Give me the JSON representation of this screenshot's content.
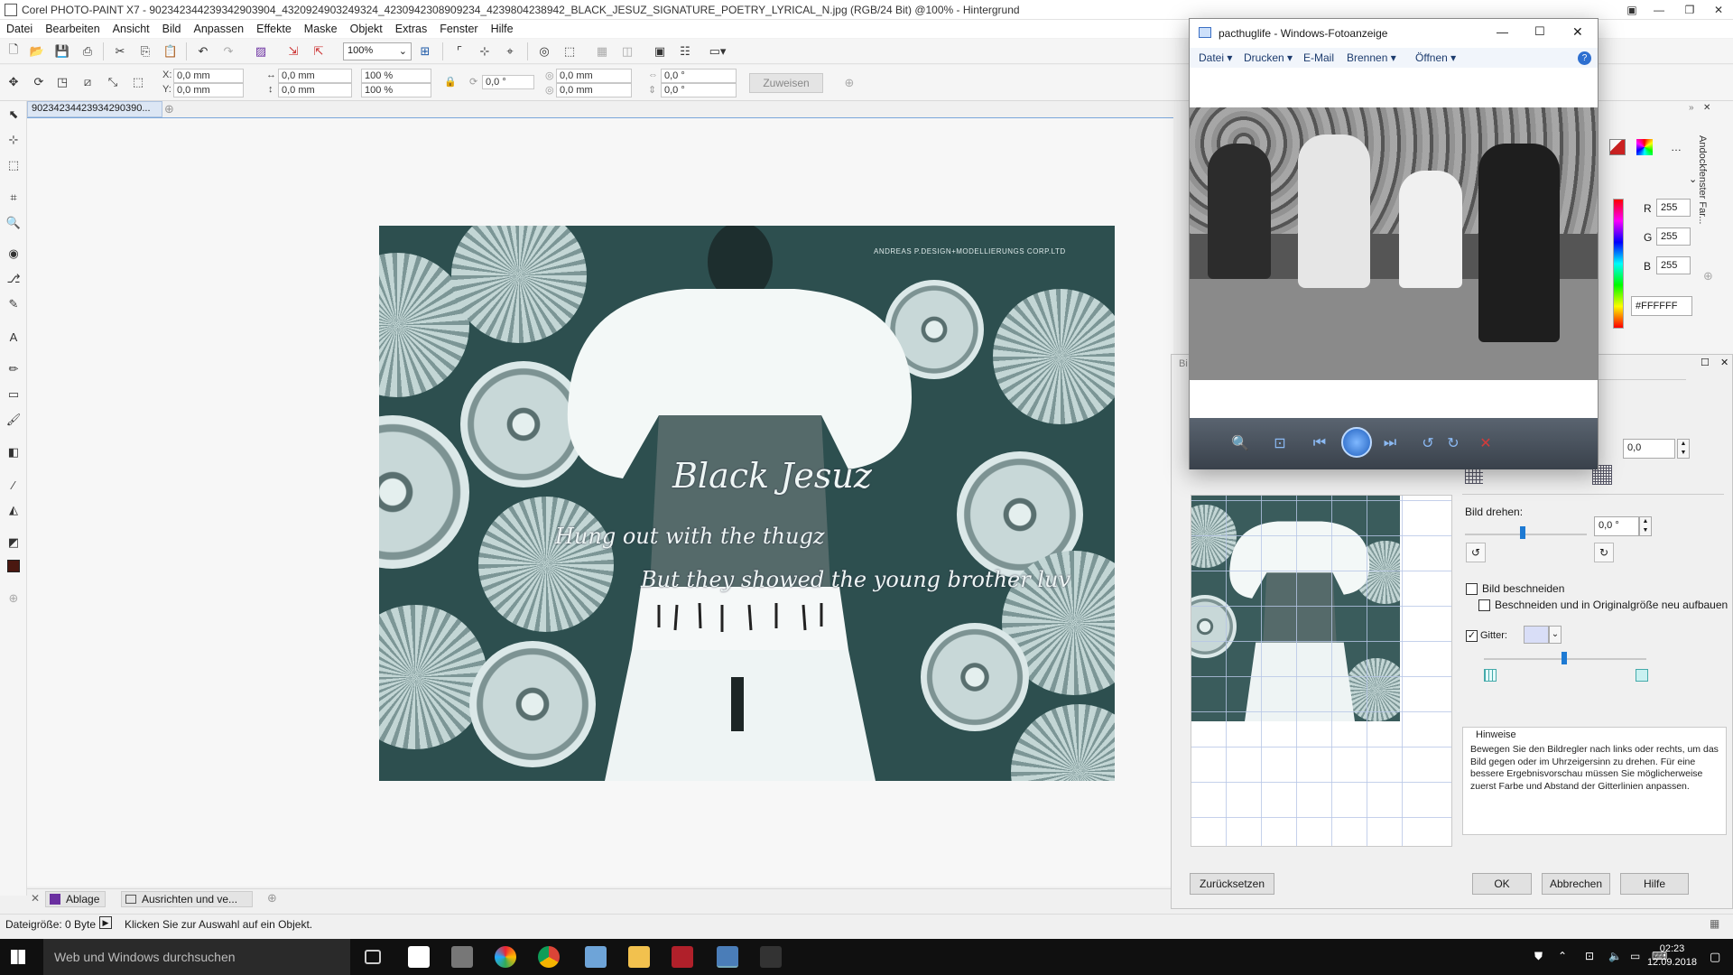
{
  "app": {
    "title": "Corel PHOTO-PAINT X7 - 902342344239342903904_4320924903249324_4230942308909234_4239804238942_BLACK_JESUZ_SIGNATURE_POETRY_LYRICAL_N.jpg (RGB/24 Bit) @100% - Hintergrund"
  },
  "menu": [
    "Datei",
    "Bearbeiten",
    "Ansicht",
    "Bild",
    "Anpassen",
    "Effekte",
    "Maske",
    "Objekt",
    "Extras",
    "Fenster",
    "Hilfe"
  ],
  "toolbar": {
    "zoom": "100%",
    "x_label": "X:",
    "x_value": "0,0 mm",
    "y_label": "Y:",
    "y_value": "0,0 mm",
    "w_value": "0,0 mm",
    "h_value": "0,0 mm",
    "scale_w": "100 %",
    "scale_h": "100 %",
    "angle": "0,0 °",
    "skew_x": "0,0 mm",
    "skew_y": "0,0 mm",
    "skew_a1": "0,0 °",
    "skew_a2": "0,0 °",
    "apply": "Zuweisen"
  },
  "document": {
    "tab": "90234234423934290390...",
    "watermark": "ANDREAS P.DESIGN+MODELLIERUNGS CORP.LTD",
    "poem_title": "Black Jesuz",
    "poem_line1": "Hung out with the thugz",
    "poem_line2": "But they showed the young brother luv"
  },
  "docker_tabs": [
    "Ablage",
    "Ausrichten und ve..."
  ],
  "status": {
    "filesize": "Dateigröße: 0 Byte",
    "hint": "Klicken Sie zur Auswahl auf ein Objekt."
  },
  "taskbar": {
    "search": "Web und Windows durchsuchen",
    "time": "02:23",
    "date": "12.09.2018"
  },
  "color_docker": {
    "title": "Andockfenster Far...",
    "r_label": "R",
    "r": "255",
    "g_label": "G",
    "g": "255",
    "b_label": "B",
    "b": "255",
    "hex": "#FFFFFF"
  },
  "dialog": {
    "title_fragment": "Bi",
    "top_value": "0,0",
    "rotate_label": "Bild drehen:",
    "rotate_value": "0,0 °",
    "crop_label": "Bild beschneiden",
    "crop_resize_label": "Beschneiden und in Originalgröße neu aufbauen",
    "grid_label": "Gitter:",
    "hint_title": "Hinweise",
    "hint_text": "Bewegen Sie den Bildregler nach links oder rechts, um das Bild gegen oder im Uhrzeigersinn zu drehen. Für eine bessere Ergebnisvorschau müssen Sie möglicherweise zuerst Farbe und Abstand der Gitterlinien anpassen.",
    "reset": "Zurücksetzen",
    "ok": "OK",
    "cancel": "Abbrechen",
    "help": "Hilfe",
    "crop_checked": false,
    "crop_resize_checked": false,
    "grid_checked": true
  },
  "photo_viewer": {
    "title": "pacthuglife - Windows-Fotoanzeige",
    "menu": [
      "Datei",
      "Drucken",
      "E-Mail",
      "Brennen",
      "Öffnen"
    ]
  },
  "colors": {
    "accent": "#1e7ad3",
    "image_tint": "#2d4f4f",
    "taskbar": "#101010",
    "delete": "#d23b3b"
  }
}
